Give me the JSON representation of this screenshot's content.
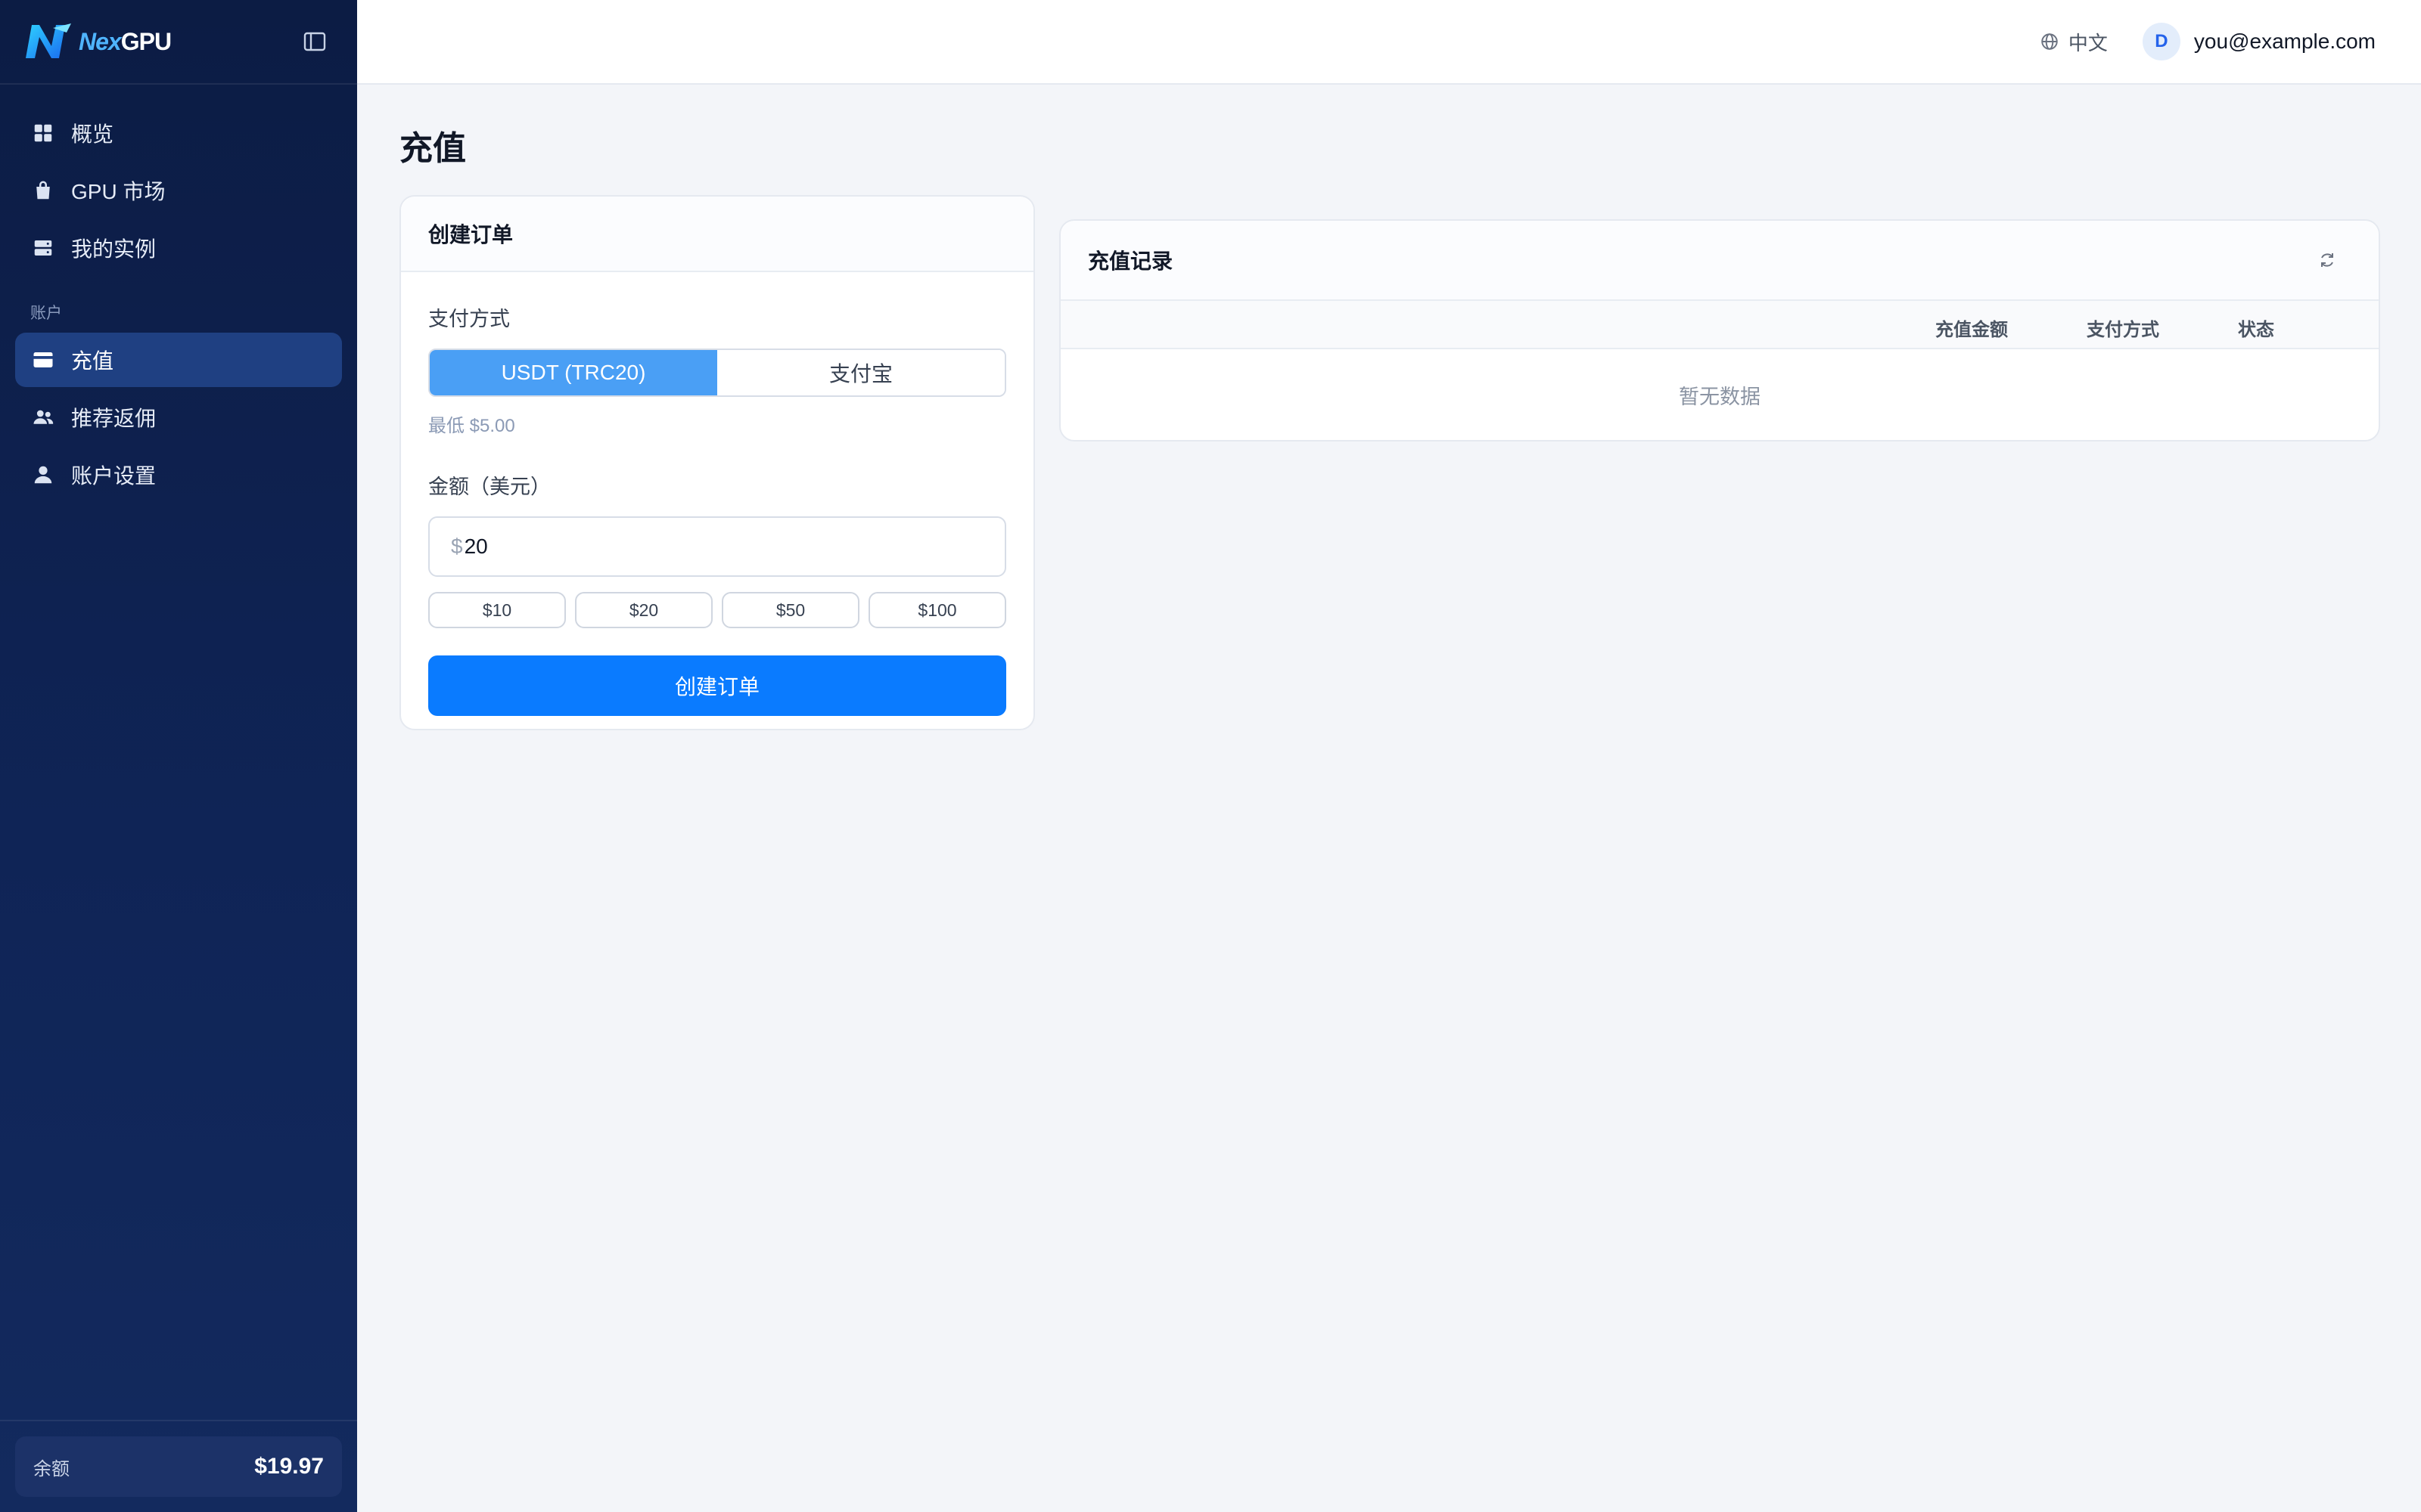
{
  "brand": {
    "name_prefix": "Nex",
    "name_suffix": "GPU"
  },
  "sidebar": {
    "items": [
      {
        "label": "概览",
        "icon": "grid-icon"
      },
      {
        "label": "GPU 市场",
        "icon": "bag-icon"
      },
      {
        "label": "我的实例",
        "icon": "server-icon"
      }
    ],
    "section_account": "账户",
    "account_items": [
      {
        "label": "充值",
        "icon": "card-icon",
        "active": true
      },
      {
        "label": "推荐返佣",
        "icon": "users-icon"
      },
      {
        "label": "账户设置",
        "icon": "user-icon"
      }
    ],
    "balance_label": "余额",
    "balance_value": "$19.97"
  },
  "topbar": {
    "language": "中文",
    "avatar_initial": "D",
    "email": "you@example.com"
  },
  "page": {
    "title": "充值"
  },
  "order": {
    "title": "创建订单",
    "payment_label": "支付方式",
    "payment_options": [
      "USDT (TRC20)",
      "支付宝"
    ],
    "payment_selected": "USDT (TRC20)",
    "min_hint": "最低 $5.00",
    "amount_label": "金额（美元）",
    "amount_prefix": "$",
    "amount_value": "20",
    "presets": [
      "$10",
      "$20",
      "$50",
      "$100"
    ],
    "submit_label": "创建订单"
  },
  "records": {
    "title": "充值记录",
    "columns": [
      "充值金额",
      "支付方式",
      "状态"
    ],
    "empty_text": "暂无数据"
  },
  "colors": {
    "sidebar_bg": "#0f2456",
    "active_nav": "#1f4082",
    "primary": "#0a7bff",
    "segment_active": "#4a9ff5"
  }
}
